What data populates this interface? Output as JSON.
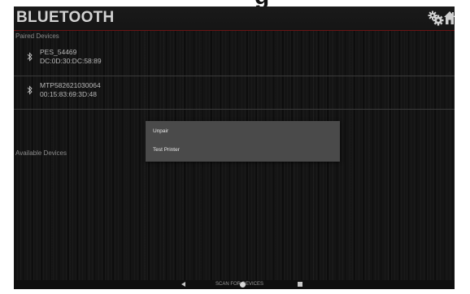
{
  "cut_off_text": "g",
  "app": {
    "title": "BLUETOOTH"
  },
  "header_icons": [
    "gears-icon",
    "home-icon"
  ],
  "paired_section": {
    "label": "Paired Devices",
    "devices": [
      {
        "name": "PES_54469",
        "address": "DC:0D:30:DC:58:89"
      },
      {
        "name": "MTP582621030064",
        "address": "00:15:83:69:3D:48"
      }
    ]
  },
  "available_section": {
    "label": "Available Devices"
  },
  "context_menu": {
    "items": [
      "Unpair",
      "Test Printer"
    ]
  },
  "bottom_bar": {
    "scan_label": "SCAN FOR DEVICES"
  },
  "colors": {
    "background": "#141414",
    "header_border": "#6a1414",
    "dialog": "#4a4a4a",
    "text": "#b8b8b8"
  }
}
